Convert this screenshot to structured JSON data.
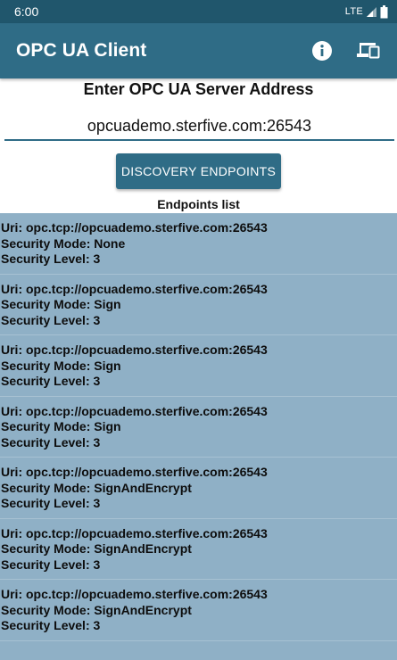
{
  "status_bar": {
    "time": "6:00",
    "network": "LTE"
  },
  "app_bar": {
    "title": "OPC UA Client",
    "actions": [
      "info-icon",
      "devices-icon"
    ]
  },
  "form": {
    "heading": "Enter OPC UA Server Address",
    "server_address": "opcuademo.sterfive.com:26543",
    "discover_label": "DISCOVERY ENDPOINTS"
  },
  "endpoints": {
    "title": "Endpoints list",
    "items": [
      {
        "uri": "Uri: opc.tcp://opcuademo.sterfive.com:26543",
        "mode": "Security Mode: None",
        "level": "Security Level: 3"
      },
      {
        "uri": "Uri: opc.tcp://opcuademo.sterfive.com:26543",
        "mode": "Security Mode: Sign",
        "level": "Security Level: 3"
      },
      {
        "uri": "Uri: opc.tcp://opcuademo.sterfive.com:26543",
        "mode": "Security Mode: Sign",
        "level": "Security Level: 3"
      },
      {
        "uri": "Uri: opc.tcp://opcuademo.sterfive.com:26543",
        "mode": "Security Mode: Sign",
        "level": "Security Level: 3"
      },
      {
        "uri": "Uri: opc.tcp://opcuademo.sterfive.com:26543",
        "mode": "Security Mode: SignAndEncrypt",
        "level": "Security Level: 3"
      },
      {
        "uri": "Uri: opc.tcp://opcuademo.sterfive.com:26543",
        "mode": "Security Mode: SignAndEncrypt",
        "level": "Security Level: 3"
      },
      {
        "uri": "Uri: opc.tcp://opcuademo.sterfive.com:26543",
        "mode": "Security Mode: SignAndEncrypt",
        "level": "Security Level: 3"
      }
    ]
  },
  "colors": {
    "status_bar": "#20566c",
    "app_bar": "#2f6c86",
    "list_background": "#8fb0c6"
  }
}
